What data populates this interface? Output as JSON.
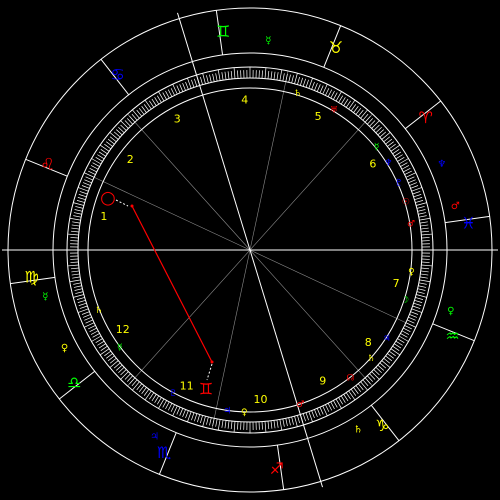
{
  "colors": {
    "background": "#000000",
    "ring": "#ffffff",
    "aspect_line": "#ff0000",
    "fire": "#ff0000",
    "earth": "#ffff00",
    "air": "#00ff00",
    "water": "#0000ff",
    "house_number": "#ffff00"
  },
  "signs": [
    {
      "name": "gemini",
      "glyph": "♊",
      "color": "#00ff00",
      "pos": "top-left-upper"
    },
    {
      "name": "taurus",
      "glyph": "♉",
      "color": "#ffff00",
      "pos": "top-right"
    },
    {
      "name": "aries",
      "glyph": "♈",
      "color": "#ff0000",
      "pos": "right-upper"
    },
    {
      "name": "pisces",
      "glyph": "♓",
      "color": "#0000ff",
      "pos": "right"
    },
    {
      "name": "aquarius",
      "glyph": "♒",
      "color": "#00ff00",
      "pos": "right-lower"
    },
    {
      "name": "capricorn",
      "glyph": "♑",
      "color": "#ffff00",
      "pos": "bottom-right"
    },
    {
      "name": "sagittarius",
      "glyph": "♐",
      "color": "#ff0000",
      "pos": "bottom"
    },
    {
      "name": "scorpio",
      "glyph": "♏",
      "color": "#0000ff",
      "pos": "bottom-left"
    },
    {
      "name": "libra",
      "glyph": "♎",
      "color": "#00ff00",
      "pos": "left-lower"
    },
    {
      "name": "virgo",
      "glyph": "♍",
      "color": "#ffff00",
      "pos": "left"
    },
    {
      "name": "leo",
      "glyph": "♌",
      "color": "#ff0000",
      "pos": "left-upper"
    },
    {
      "name": "cancer",
      "glyph": "♋",
      "color": "#0000ff",
      "pos": "top-left"
    }
  ],
  "houses": [
    {
      "number": "1"
    },
    {
      "number": "2"
    },
    {
      "number": "3"
    },
    {
      "number": "4"
    },
    {
      "number": "5"
    },
    {
      "number": "6"
    },
    {
      "number": "7"
    },
    {
      "number": "8"
    },
    {
      "number": "9"
    },
    {
      "number": "10"
    },
    {
      "number": "11"
    },
    {
      "number": "12"
    }
  ],
  "outer_planets": [
    {
      "name": "mercury",
      "glyph": "☿",
      "color": "#00ff00"
    },
    {
      "name": "neptune",
      "glyph": "♆",
      "color": "#0000ff"
    },
    {
      "name": "mars",
      "glyph": "♂",
      "color": "#ff0000"
    },
    {
      "name": "mercury-left",
      "glyph": "☿",
      "color": "#00ff00"
    },
    {
      "name": "venus-left",
      "glyph": "♀",
      "color": "#ffff00"
    },
    {
      "name": "jupiter",
      "glyph": "♃",
      "color": "#0000ff"
    },
    {
      "name": "saturn",
      "glyph": "♄",
      "color": "#ffff00"
    },
    {
      "name": "venus-right",
      "glyph": "♀",
      "color": "#00ff00"
    }
  ],
  "inner_planets": [
    {
      "name": "saturn-inner",
      "glyph": "♄",
      "color": "#ffff00"
    },
    {
      "name": "uranus-inner",
      "glyph": "♅",
      "color": "#ff0000"
    },
    {
      "name": "mercury-inner",
      "glyph": "☿",
      "color": "#00ff00"
    },
    {
      "name": "neptune-inner",
      "glyph": "♆",
      "color": "#0000ff"
    },
    {
      "name": "pluto-inner",
      "glyph": "♇",
      "color": "#0000ff"
    },
    {
      "name": "sun",
      "glyph": "☉",
      "color": "#ff0000"
    },
    {
      "name": "mars-inner",
      "glyph": "♂",
      "color": "#ff0000"
    },
    {
      "name": "venus-inner",
      "glyph": "♀",
      "color": "#ffff00"
    },
    {
      "name": "moon-inner",
      "glyph": "☽",
      "color": "#00ff00"
    },
    {
      "name": "jupiter-inner",
      "glyph": "♃",
      "color": "#0000ff"
    },
    {
      "name": "saturn-inner-2",
      "glyph": "♄",
      "color": "#ffff00"
    },
    {
      "name": "node",
      "glyph": "☊",
      "color": "#ff0000"
    },
    {
      "name": "mars-inner-2",
      "glyph": "♂",
      "color": "#ff0000"
    },
    {
      "name": "venus-inner-2",
      "glyph": "♀",
      "color": "#ffff00"
    },
    {
      "name": "jupiter-inner-2",
      "glyph": "♃",
      "color": "#0000ff"
    },
    {
      "name": "pluto-inner-2",
      "glyph": "♇",
      "color": "#0000ff"
    },
    {
      "name": "mercury-inner-2",
      "glyph": "☿",
      "color": "#00ff00"
    },
    {
      "name": "saturn-inner-3",
      "glyph": "♄",
      "color": "#ffff00"
    }
  ],
  "aspect": {
    "from_glyph": "○",
    "to_glyph": "♊",
    "color": "#ff0000"
  }
}
